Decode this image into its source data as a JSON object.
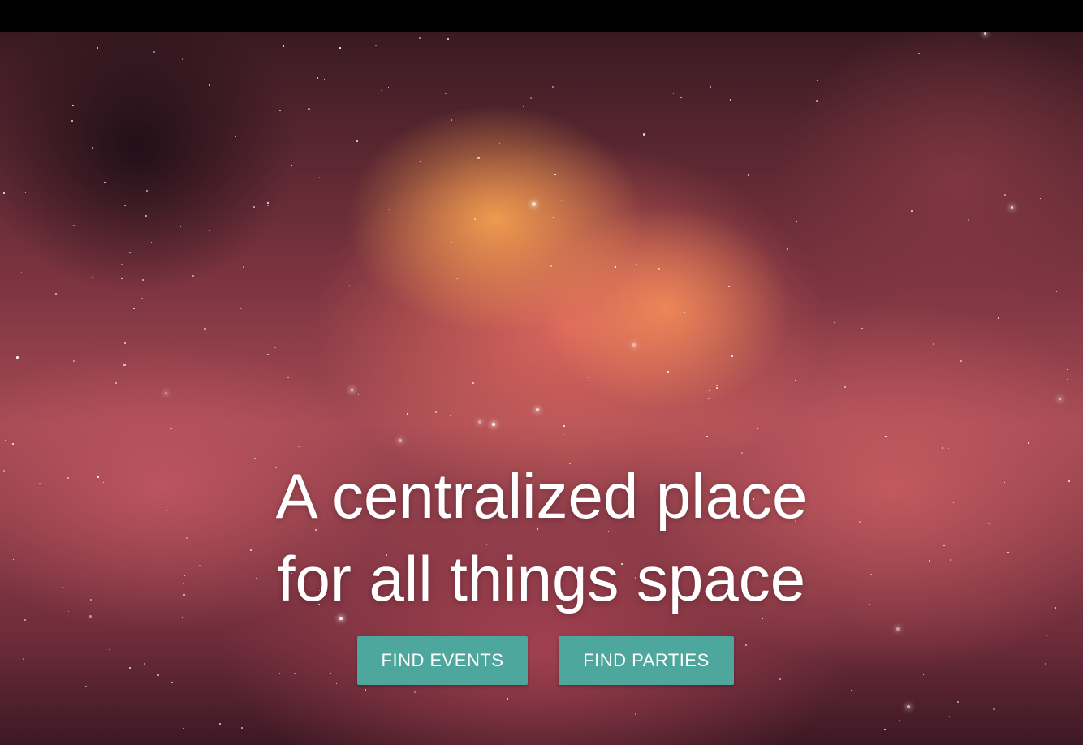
{
  "hero": {
    "headline": "A centralized place for all things space",
    "buttons": {
      "events_label": "FIND EVENTS",
      "parties_label": "FIND PARTIES"
    }
  },
  "colors": {
    "button_bg": "#4ea79c",
    "button_text": "#ffffff",
    "top_bar": "#000000"
  }
}
